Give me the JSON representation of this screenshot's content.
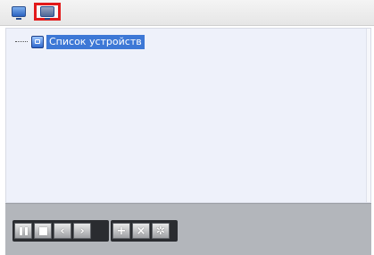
{
  "tabs": [
    {
      "icon": "monitor-icon",
      "selected": false
    },
    {
      "icon": "monitor-icon",
      "selected": true,
      "highlight_color": "#e21a1a"
    }
  ],
  "tree": {
    "root": {
      "label": "Список устройств",
      "icon": "device-list-icon",
      "selected": true
    }
  },
  "toolbar": {
    "playback": [
      "pause",
      "stop",
      "previous",
      "next"
    ],
    "actions": [
      "add",
      "remove",
      "settings"
    ],
    "glyphs": {
      "previous": "‹",
      "next": "›",
      "add": "+",
      "remove": "×",
      "settings": "✲"
    }
  },
  "colors": {
    "selection": "#3d78d6",
    "panel_bg": "#eef1fa",
    "toolbar_bg": "#b3b6bb"
  }
}
